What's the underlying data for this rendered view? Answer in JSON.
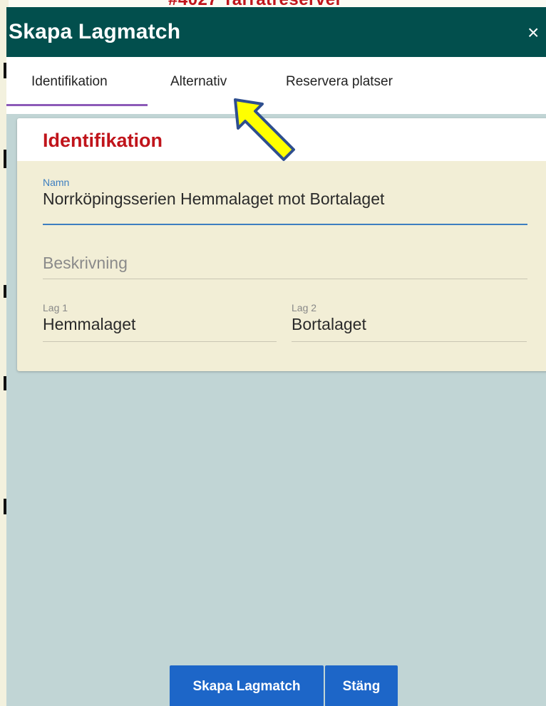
{
  "dialog": {
    "title": "Skapa Lagmatch",
    "close_glyph": "×"
  },
  "tabs": [
    {
      "label": "Identifikation",
      "active": true
    },
    {
      "label": "Alternativ",
      "active": false
    },
    {
      "label": "Reservera platser",
      "active": false
    }
  ],
  "section": {
    "heading": "Identifikation"
  },
  "form": {
    "namn_label": "Namn",
    "namn_value": "Norrköpingsserien Hemmalaget mot Bortalaget",
    "beskrivning_placeholder": "Beskrivning",
    "lag1_label": "Lag 1",
    "lag1_value": "Hemmalaget",
    "lag2_label": "Lag 2",
    "lag2_value": "Bortalaget"
  },
  "buttons": {
    "create_label": "Skapa Lagmatch",
    "close_label": "Stäng"
  },
  "annotation": {
    "arrow_color": "#ffff00",
    "arrow_outline": "#2f4f8f"
  },
  "colors": {
    "titlebar": "#024f4d",
    "heading": "#c0141b",
    "button": "#1d66c8",
    "active_tab_underline": "#8c5ab8",
    "focus_field": "#3d7ec0"
  }
}
